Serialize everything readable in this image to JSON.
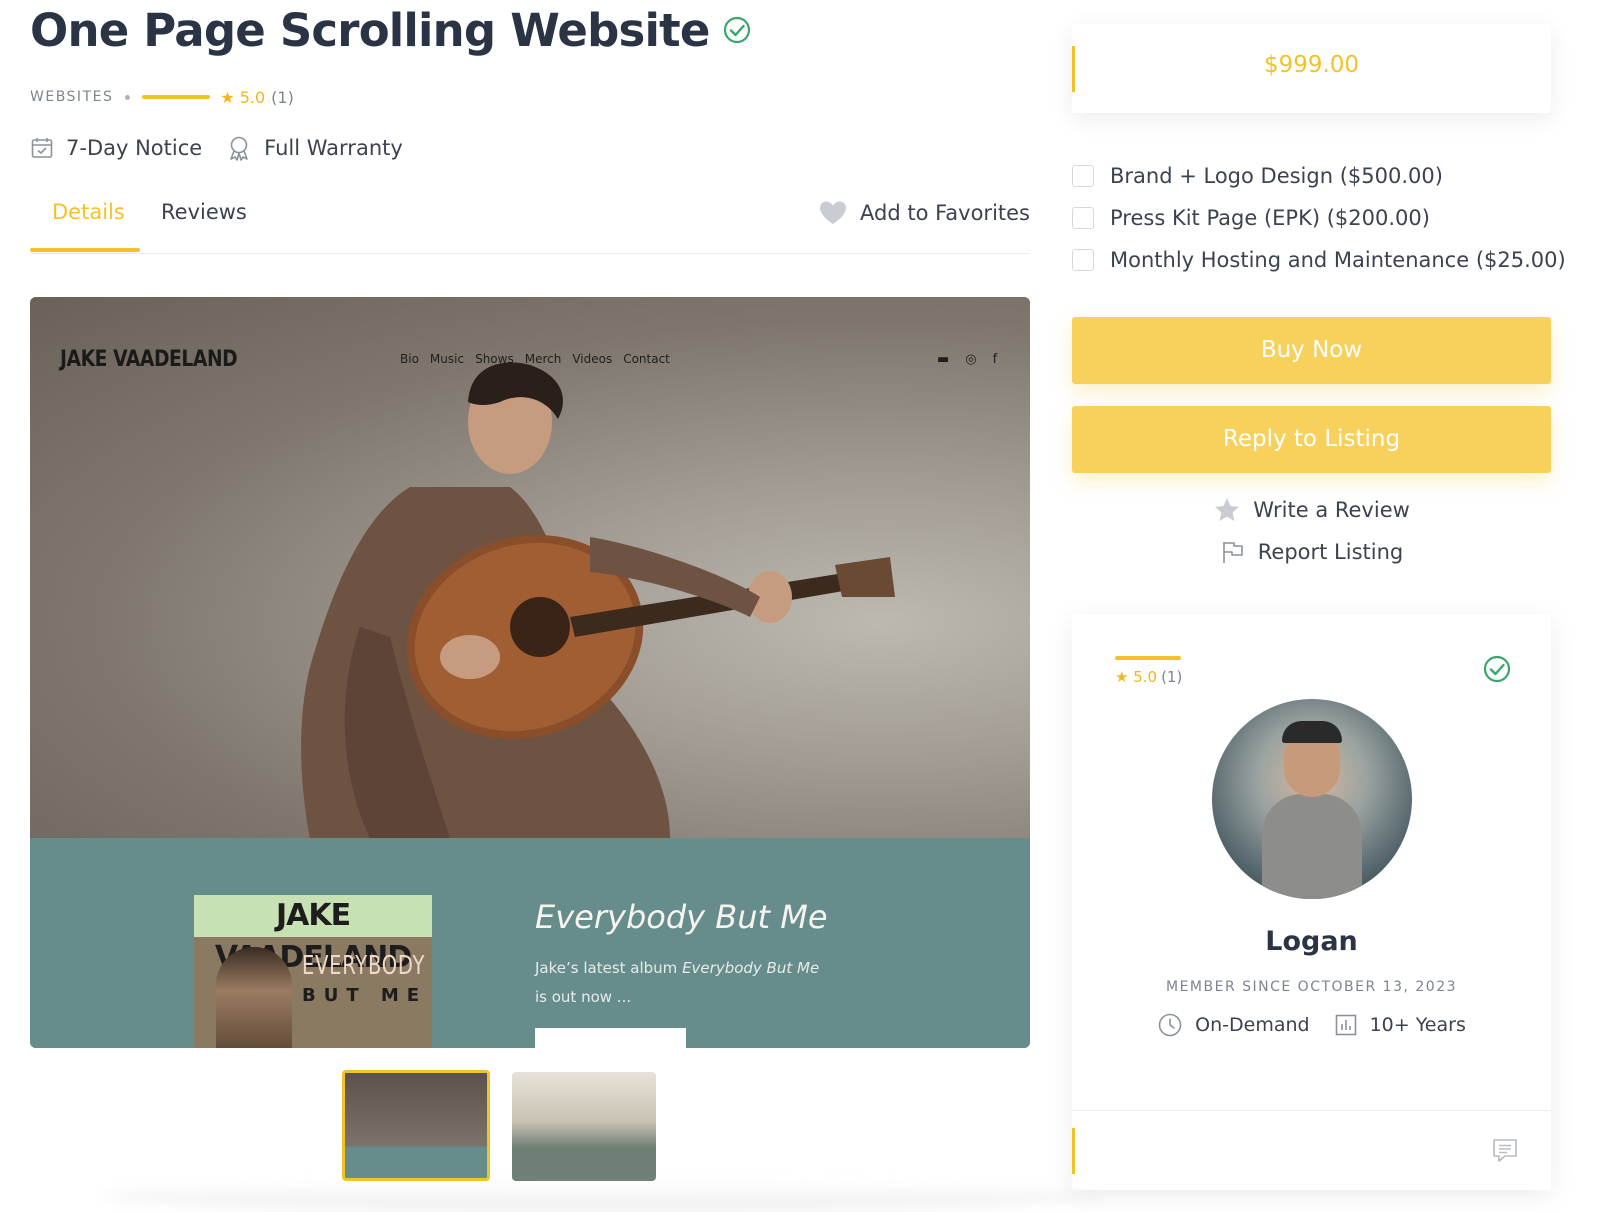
{
  "listing": {
    "title": "One Page Scrolling Website",
    "category": "WEBSITES",
    "rating": "5.0",
    "rating_count": "(1)",
    "rating_fraction": 1.0,
    "features": [
      {
        "icon": "calendar-check-icon",
        "label": "7-Day Notice"
      },
      {
        "icon": "award-ribbon-icon",
        "label": "Full Warranty"
      }
    ]
  },
  "tabs": [
    {
      "label": "Details",
      "active": true
    },
    {
      "label": "Reviews",
      "active": false
    }
  ],
  "favorites_label": "Add to Favorites",
  "hero": {
    "site_logo": "JAKE VAADELAND",
    "site_nav": [
      "Bio",
      "Music",
      "Shows",
      "Merch",
      "Videos",
      "Contact"
    ],
    "social_icons": [
      "youtube-icon",
      "instagram-icon",
      "facebook-icon"
    ],
    "social_glyphs": [
      "▬",
      "◎",
      "f"
    ],
    "album_artist": "JAKE VAADELAND",
    "album_title_1": "EVERYBODY",
    "album_title_2": "BUT ME",
    "promo_title": "Everybody But Me",
    "promo_text_before": "Jake’s latest album ",
    "promo_text_em": "Everybody But Me",
    "promo_text_after": "is out now ..."
  },
  "thumbnails": [
    {
      "name": "thumbnail-1",
      "active": true
    },
    {
      "name": "thumbnail-2",
      "active": false
    }
  ],
  "sidebar": {
    "price": "$999.00",
    "addons": [
      {
        "label": "Brand + Logo Design ($500.00)",
        "checked": false
      },
      {
        "label": "Press Kit Page (EPK) ($200.00)",
        "checked": false
      },
      {
        "label": "Monthly Hosting and Maintenance ($25.00)",
        "checked": false
      }
    ],
    "buy_label": "Buy Now",
    "reply_label": "Reply to Listing",
    "write_review_label": "Write a Review",
    "report_label": "Report Listing"
  },
  "seller": {
    "rating": "5.0",
    "rating_count": "(1)",
    "name": "Logan",
    "member_since": "MEMBER SINCE OCTOBER 13, 2023",
    "availability": "On-Demand",
    "experience": "10+ Years"
  },
  "colors": {
    "accent": "#f3c229",
    "button": "#f7d15c",
    "verified": "#3aa56b",
    "text": "#2b3445"
  }
}
